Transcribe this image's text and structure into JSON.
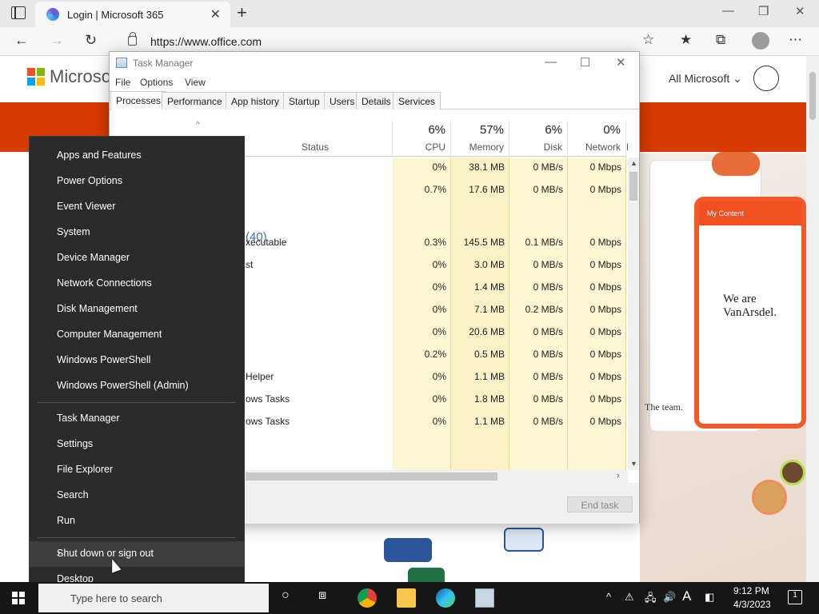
{
  "browser": {
    "tab_title": "Login | Microsoft 365",
    "url": "https://www.office.com"
  },
  "office": {
    "brand": "Microsoft",
    "all_microsoft": "All Microsoft",
    "hero_text": "We are VanArsdel.",
    "team_text": "The team.",
    "phone_title": "My Content"
  },
  "taskmanager": {
    "title": "Task Manager",
    "menu": [
      "File",
      "Options",
      "View"
    ],
    "tabs": [
      "Processes",
      "Performance",
      "App history",
      "Startup",
      "Users",
      "Details",
      "Services"
    ],
    "status_header": "Status",
    "columns": [
      {
        "pct": "6%",
        "name": "CPU"
      },
      {
        "pct": "57%",
        "name": "Memory"
      },
      {
        "pct": "6%",
        "name": "Disk"
      },
      {
        "pct": "0%",
        "name": "Network"
      }
    ],
    "cut_column": "P",
    "group_label": "(40)",
    "rows": [
      {
        "name": "",
        "cpu": "0%",
        "mem": "38.1 MB",
        "disk": "0 MB/s",
        "net": "0 Mbps"
      },
      {
        "name": "",
        "cpu": "0.7%",
        "mem": "17.6 MB",
        "disk": "0 MB/s",
        "net": "0 Mbps"
      },
      {
        "name": "xecutable",
        "cpu": "0.3%",
        "mem": "145.5 MB",
        "disk": "0.1 MB/s",
        "net": "0 Mbps"
      },
      {
        "name": "st",
        "cpu": "0%",
        "mem": "3.0 MB",
        "disk": "0 MB/s",
        "net": "0 Mbps"
      },
      {
        "name": "",
        "cpu": "0%",
        "mem": "1.4 MB",
        "disk": "0 MB/s",
        "net": "0 Mbps"
      },
      {
        "name": "",
        "cpu": "0%",
        "mem": "7.1 MB",
        "disk": "0.2 MB/s",
        "net": "0 Mbps"
      },
      {
        "name": "",
        "cpu": "0%",
        "mem": "20.6 MB",
        "disk": "0 MB/s",
        "net": "0 Mbps"
      },
      {
        "name": "",
        "cpu": "0.2%",
        "mem": "0.5 MB",
        "disk": "0 MB/s",
        "net": "0 Mbps"
      },
      {
        "name": "Helper",
        "cpu": "0%",
        "mem": "1.1 MB",
        "disk": "0 MB/s",
        "net": "0 Mbps"
      },
      {
        "name": "ows Tasks",
        "cpu": "0%",
        "mem": "1.8 MB",
        "disk": "0 MB/s",
        "net": "0 Mbps"
      },
      {
        "name": "ows Tasks",
        "cpu": "0%",
        "mem": "1.1 MB",
        "disk": "0 MB/s",
        "net": "0 Mbps"
      }
    ],
    "end_task": "End task"
  },
  "context_menu": {
    "group1": [
      "Apps and Features",
      "Power Options",
      "Event Viewer",
      "System",
      "Device Manager",
      "Network Connections",
      "Disk Management",
      "Computer Management",
      "Windows PowerShell",
      "Windows PowerShell (Admin)"
    ],
    "group2": [
      "Task Manager",
      "Settings",
      "File Explorer",
      "Search",
      "Run"
    ],
    "group3": [
      "Shut down or sign out",
      "Desktop"
    ]
  },
  "taskbar": {
    "search_placeholder": "Type here to search",
    "time": "9:12 PM",
    "date": "4/3/2023",
    "notification_count": "1",
    "ime": "A"
  }
}
